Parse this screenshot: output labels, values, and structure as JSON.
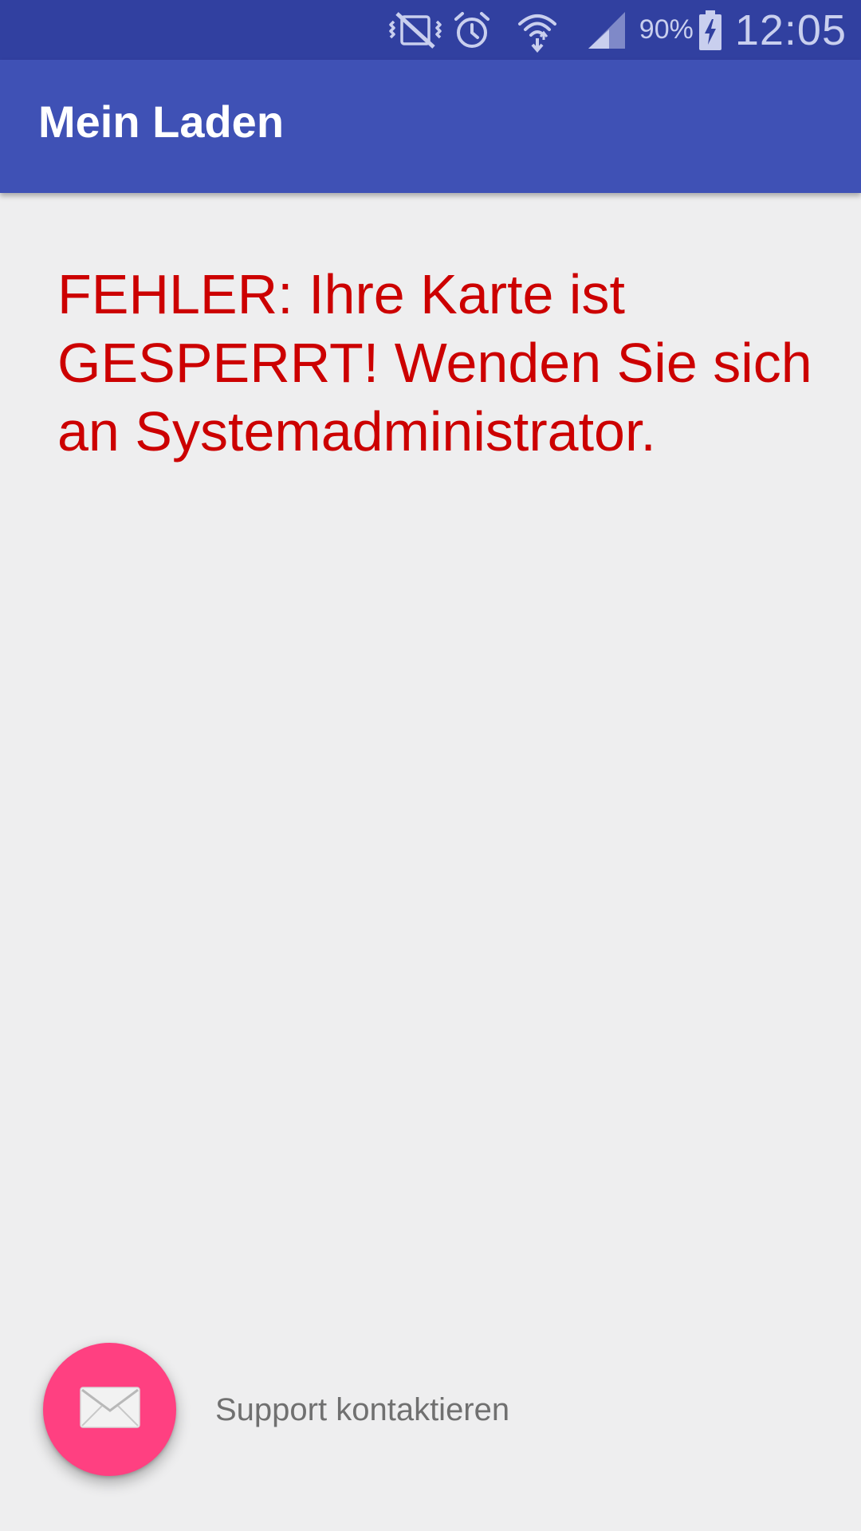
{
  "status_bar": {
    "icons": [
      "vibrate-icon",
      "alarm-icon",
      "wifi-icon",
      "signal-icon",
      "battery-charging-icon"
    ],
    "battery_percent": "90%",
    "time": "12:05",
    "background_color": "#3140a0"
  },
  "app_bar": {
    "title": "Mein Laden",
    "background_color": "#3f51b5"
  },
  "main": {
    "error_message": "FEHLER: Ihre Karte ist GESPERRT! Wenden Sie sich an Systemadministrator.",
    "error_color": "#cc0000"
  },
  "support": {
    "icon": "mail-icon",
    "label": "Support kontaktieren",
    "fab_color": "#ff4081"
  }
}
